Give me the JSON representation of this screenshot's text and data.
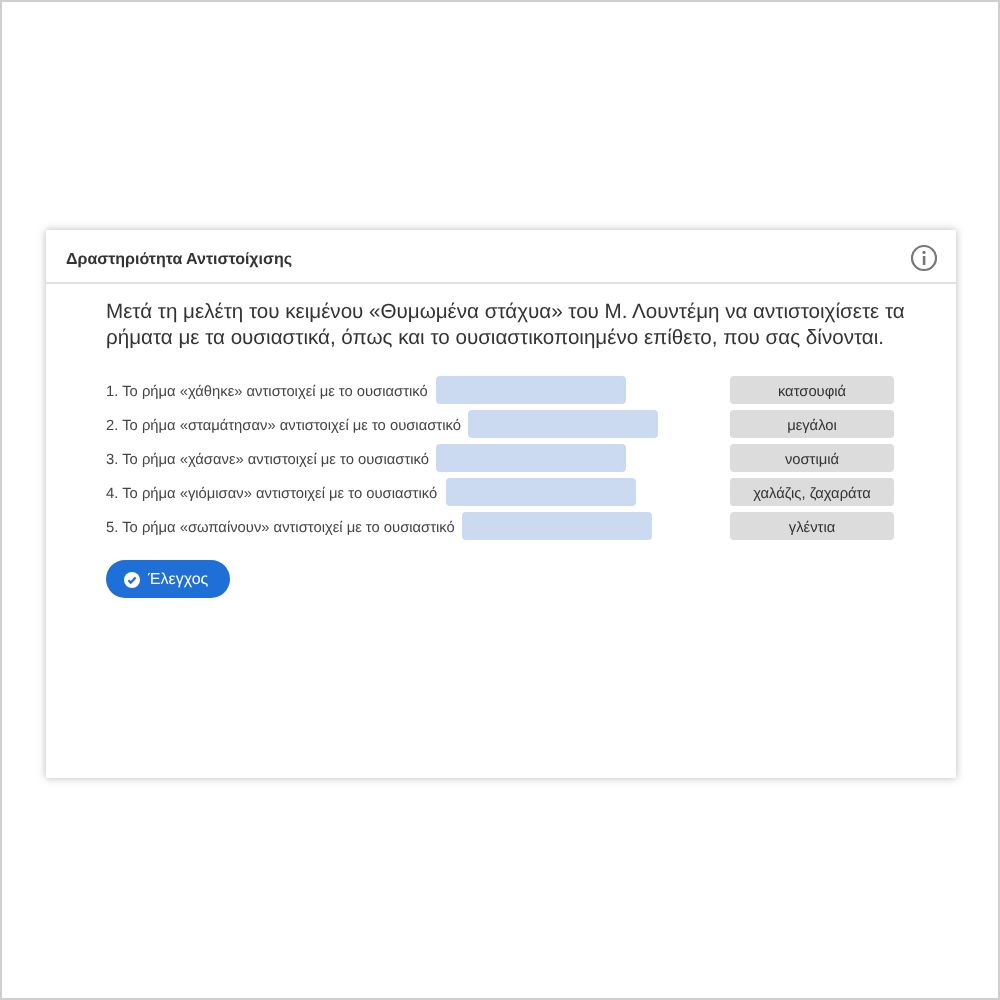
{
  "card": {
    "title": "Δραστηριότητα Αντιστοίχισης",
    "instruction": "Μετά τη μελέτη του κειμένου «Θυμωμένα στάχυα» του Μ. Λουντέμη να αντιστοιχίσετε τα ρήματα με τα ουσιαστικά, όπως και το ουσιαστικοποιημένο επίθετο, που σας δίνονται.",
    "items": [
      {
        "prompt": "1. Το ρήμα «χάθηκε» αντιστοιχεί με το ουσιαστικό"
      },
      {
        "prompt": "2. Το ρήμα «σταμάτησαν» αντιστοιχεί με το ουσιαστικό"
      },
      {
        "prompt": "3. Το ρήμα «χάσανε» αντιστοιχεί με το ουσιαστικό"
      },
      {
        "prompt": "4. Το ρήμα «γιόμισαν» αντιστοιχεί με το ουσιαστικό"
      },
      {
        "prompt": "5. Το ρήμα «σωπαίνουν» αντιστοιχεί με το ουσιαστικό"
      }
    ],
    "choices": [
      "κατσουφιά",
      "μεγάλοι",
      "νοστιμιά",
      "χαλάζις, ζαχαράτα",
      "γλέντια"
    ],
    "check_button": "Έλεγχος"
  }
}
